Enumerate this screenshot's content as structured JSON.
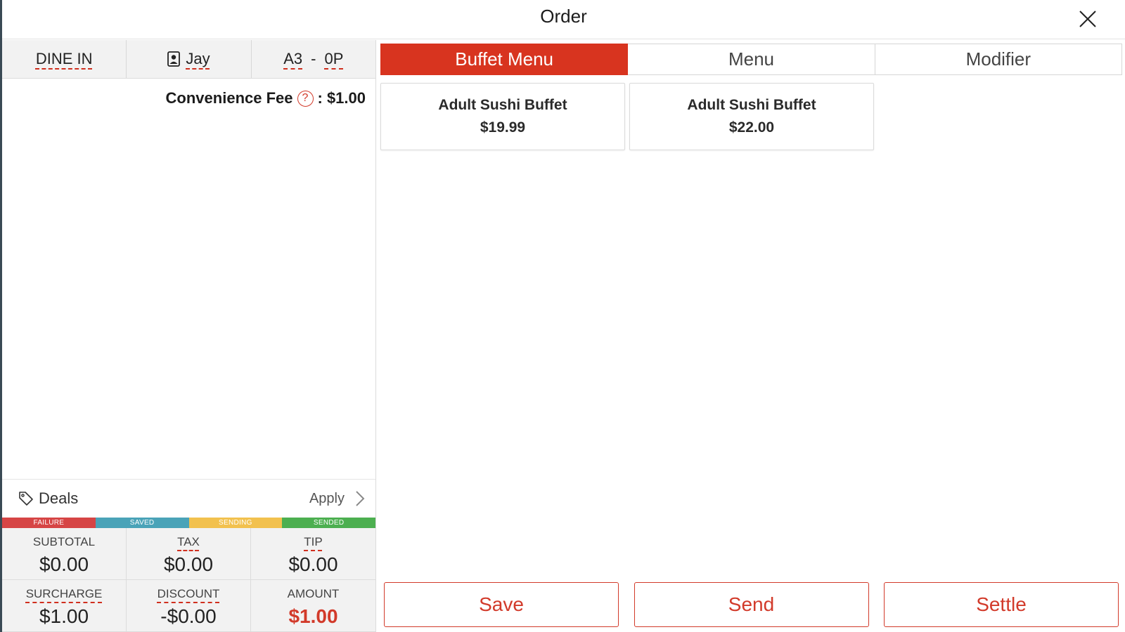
{
  "header": {
    "title": "Order"
  },
  "order_info": {
    "type": "DINE IN",
    "server": "Jay",
    "table": "A3",
    "table_separator": "-",
    "guests": "0P"
  },
  "fee": {
    "label": "Convenience Fee",
    "help": "?",
    "value": ": $1.00"
  },
  "deals": {
    "label": "Deals",
    "action": "Apply"
  },
  "status_legend": [
    {
      "label": "FAILURE",
      "color": "#d64545"
    },
    {
      "label": "SAVED",
      "color": "#4aa3b8"
    },
    {
      "label": "SENDING",
      "color": "#f2c14e"
    },
    {
      "label": "SENDED",
      "color": "#4caf50"
    }
  ],
  "totals": {
    "subtotal": {
      "label": "SUBTOTAL",
      "value": "$0.00"
    },
    "tax": {
      "label": "TAX",
      "value": "$0.00"
    },
    "tip": {
      "label": "TIP",
      "value": "$0.00"
    },
    "surcharge": {
      "label": "SURCHARGE",
      "value": "$1.00"
    },
    "discount": {
      "label": "DISCOUNT",
      "value": "-$0.00"
    },
    "amount": {
      "label": "AMOUNT",
      "value": "$1.00"
    }
  },
  "tabs": [
    {
      "label": "Buffet Menu",
      "active": true
    },
    {
      "label": "Menu",
      "active": false
    },
    {
      "label": "Modifier",
      "active": false
    }
  ],
  "items": [
    {
      "name": "Adult Sushi Buffet",
      "price": "$19.99"
    },
    {
      "name": "Adult Sushi Buffet",
      "price": "$22.00"
    }
  ],
  "actions": {
    "save": "Save",
    "send": "Send",
    "settle": "Settle"
  },
  "colors": {
    "accent": "#d8341f"
  },
  "icons": {
    "close": "close-icon",
    "person": "person-badge-icon",
    "help": "help-circle-icon",
    "tag": "tag-icon",
    "chevron": "chevron-right-icon"
  }
}
